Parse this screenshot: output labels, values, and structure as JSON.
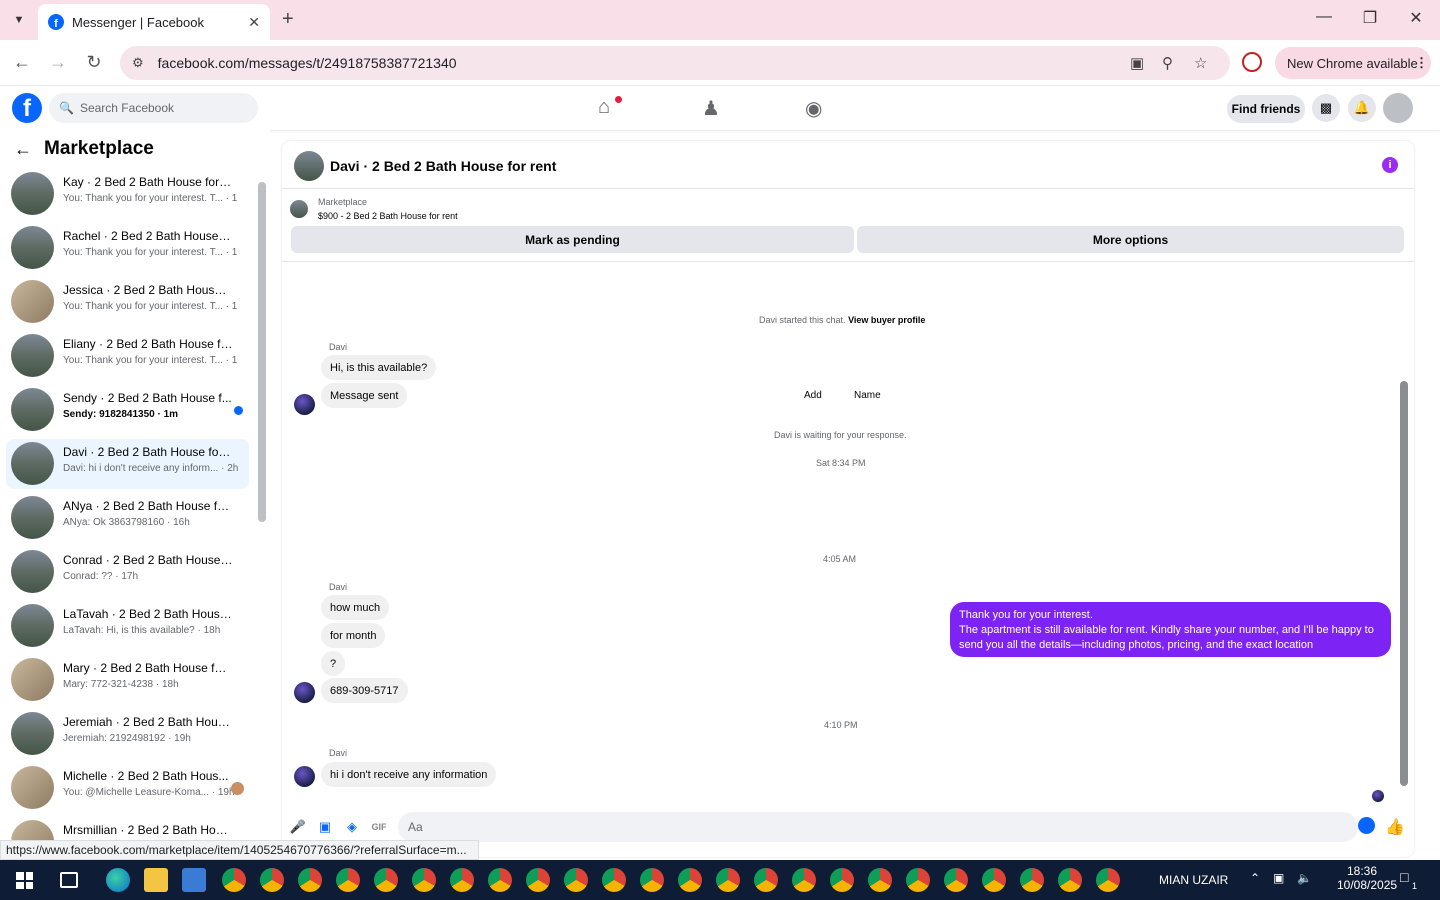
{
  "browser": {
    "tab_title": "Messenger | Facebook",
    "url": "facebook.com/messages/t/24918758387721340",
    "new_chrome": "New Chrome available",
    "status_url": "https://www.facebook.com/marketplace/item/1405254670776366/?referralSurface=m..."
  },
  "fb": {
    "search_placeholder": "Search Facebook",
    "find_friends": "Find friends"
  },
  "sidebar": {
    "title": "Marketplace",
    "conversations": [
      {
        "name": "Kay · 2 Bed 2 Bath House for rent",
        "preview": "You: Thank you for your interest. T... · 1m"
      },
      {
        "name": "Rachel · 2 Bed 2 Bath House for...",
        "preview": "You: Thank you for your interest. T... · 1m"
      },
      {
        "name": "Jessica · 2 Bed 2 Bath House for...",
        "preview": "You: Thank you for your interest. T... · 1m"
      },
      {
        "name": "Eliany · 2 Bed 2 Bath House for ...",
        "preview": "You: Thank you for your interest. T... · 1m"
      },
      {
        "name": "Sendy · 2 Bed 2 Bath House f...",
        "preview": "Sendy: 9182841350 · 1m"
      },
      {
        "name": "Davi · 2 Bed 2 Bath House for r...",
        "preview": "Davi: hi i don't receive any inform... · 2h"
      },
      {
        "name": "ANya · 2 Bed 2 Bath House for r...",
        "preview": "ANya: Ok 3863798160 · 16h"
      },
      {
        "name": "Conrad · 2 Bed 2 Bath House fo...",
        "preview": "Conrad: ?? · 17h"
      },
      {
        "name": "LaTavah · 2 Bed 2 Bath House f...",
        "preview": "LaTavah: Hi, is this available? · 18h"
      },
      {
        "name": "Mary · 2 Bed 2 Bath House for r...",
        "preview": "Mary: 772-321-4238 · 18h"
      },
      {
        "name": "Jeremiah · 2 Bed 2 Bath House f...",
        "preview": "Jeremiah: 2192498192 · 19h"
      },
      {
        "name": "Michelle · 2 Bed 2 Bath Hous...",
        "preview": "You: @Michelle Leasure-Koma... · 19h"
      },
      {
        "name": "Mrsmillian · 2 Bed 2 Bath Hous...",
        "preview": ""
      }
    ]
  },
  "chat": {
    "title": "Davi · 2 Bed 2 Bath House for rent",
    "listing_source": "Marketplace",
    "listing_title": "$900 - 2 Bed 2 Bath House for rent",
    "mark_pending": "Mark as pending",
    "more_options": "More options",
    "add_label": "Add",
    "name_label": "Name",
    "started_text": "Davi started this chat.",
    "view_buyer": "View buyer profile",
    "sender": "Davi",
    "msg1": "Hi, is this available?",
    "msg2": "Message sent",
    "waiting": "Davi is waiting for your response.",
    "time1": "Sat 8:34 PM",
    "out_line1": "Thank you for your interest.",
    "out_line2": "The apartment is still available for rent. Kindly share your number, and I'll be happy to send you all the details—including photos, pricing, and the exact location",
    "time2": "4:05 AM",
    "msg3": "how much",
    "msg4": "for month",
    "msg5": "?",
    "msg6": "689-309-5717",
    "time3": "4:10 PM",
    "msg7": "hi i don't receive any information",
    "composer_placeholder": "Aa"
  },
  "taskbar": {
    "user": "MIAN UZAIR",
    "time": "18:36",
    "date": "10/08/2025",
    "notif_count": "1"
  },
  "colors": {
    "accent": "#0866ff",
    "outgoing": "#7d24f5",
    "tab_bg": "#f9dfe8"
  }
}
